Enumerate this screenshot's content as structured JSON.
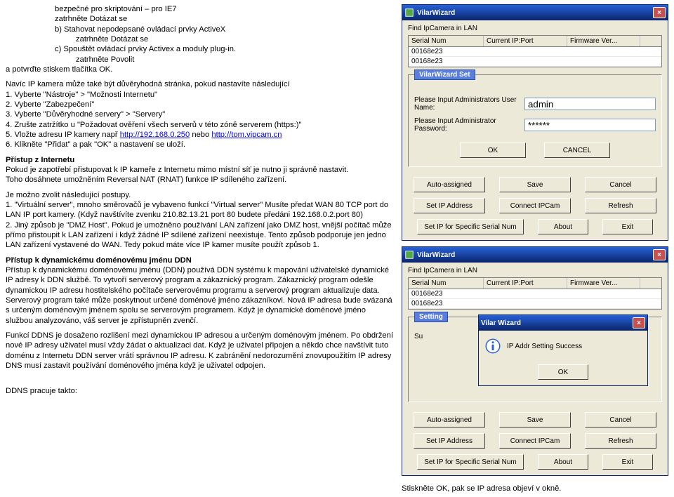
{
  "doc": {
    "l1": "bezpečné pro skriptování – pro IE7",
    "l2": "zatrhněte Dotázat se",
    "l3": "b) Stahovat nepodepsané ovládací prvky ActiveX",
    "l4": "zatrhněte Dotázat se",
    "l5": "c) Spouštět ovládací prvky Activex a moduly plug-in.",
    "l6": "zatrhněte Povolit",
    "l7": "a potvrďte stiskem tlačítka OK.",
    "p1a": "Navíc IP kamera může také být důvěryhodná stránka, pokud nastavíte následující",
    "p1b": "1. Vyberte \"Nástroje\" > \"Možnosti Internetu\"",
    "p1c": "2. Vyberte \"Zabezpečení\"",
    "p1d": "3. Vyberte \"Důvěryhodné servery\" > \"Servery\"",
    "p1e": "4. Zrušte zatržítko u \"Požadovat ověření všech serverů v této zóně serverem (https:)\"",
    "p1f_pre": "5. Vložte adresu IP kamery např ",
    "p1f_link1": "http://192.168.0.250",
    "p1f_mid": " nebo ",
    "p1f_link2": "http://tom.vipcam.cn",
    "p1g": "6. Klikněte \"Přidat\" a pak \"OK\" a nastavení se uloží.",
    "h2": "Přístup z Internetu",
    "p2a": "Pokud je zapotřebí přistupovat k IP kameře z Internetu mimo místní síť je nutno ji správně nastavit.",
    "p2b": "Toho dosáhnete umožněním Reversal NAT (RNAT) funkce IP sdíleného zařízení.",
    "p3a": "Je možno zvolit následující postupy.",
    "p3b": "1. \"Virtuální server\", mnoho směrovačů je vybaveno funkcí \"Virtual server\" Musíte předat WAN 80 TCP port do LAN IP port kamery. (Když navštívíte zvenku 210.82.13.21 port 80 budete předáni 192.168.0.2.port 80)",
    "p3c": "2. Jiný způsob je \"DMZ Host\". Pokud je umožněno používání LAN zařízení jako DMZ host, vnější počítač může přímo přistoupit k LAN zařízení i když žádné IP sdílené zařízení neexistuje. Tento způsob podporuje jen jedno LAN zařízení vystavené do WAN. Tedy pokud máte více IP kamer musíte použít způsob 1.",
    "h3": "Přístup k dynamickému doménovému jménu DDN",
    "p4": "Přístup k dynamickému doménovému jménu (DDN) používá DDN systému k mapování uživatelské dynamické IP adresy k DDN službě. To vytvoří serverový program a zákaznický program. Zákaznický program odešle dynamickou IP adresu hostitelského počítače serverovému programu a serverový program aktualizuje data. Serverový program také může poskytnout určené doménové jméno zákazníkovi. Nová IP adresa bude svázaná s určeným doménovým jménem spolu se serverovým programem. Když je dynamické doménové jméno službou analyzováno, váš server je zpřístupněn zvenčí.",
    "p5": "Funkcí DDNS je dosaženo rozlišení mezi dynamickou IP adresou a určeným doménovým jménem. Po obdržení nové IP adresy uživatel musí vždy žádat o aktualizaci dat. Když je uživatel připojen a někdo chce navštívit tuto doménu z Internetu DDN server vrátí správnou IP adresu. K zabránění nedorozumění znovupoužitím IP adresy DNS musí zastavit používání doménového jména když je uživatel odpojen.",
    "p6": "DDNS pracuje takto:"
  },
  "wiz": {
    "title": "VilarWizard",
    "findLbl": "Find IpCamera in LAN",
    "th": {
      "c1": "Serial Num",
      "c2": "Current IP:Port",
      "c3": "Firmware Ver..."
    },
    "rows": [
      {
        "c1": "00168e23",
        "c2": "",
        "c3": ""
      },
      {
        "c1": "00168e23",
        "c2": "",
        "c3": ""
      }
    ],
    "setTitle": "VilarWizard Set",
    "lblUser": "Please Input Administrators User Name:",
    "valUser": "admin",
    "lblPass": "Please Input Administrator Password:",
    "valPass": "******",
    "okBtn": "OK",
    "cancelBtn": "CANCEL",
    "b_auto": "Auto-assigned",
    "b_save": "Save",
    "b_cancel": "Cancel",
    "b_setip": "Set IP Address",
    "b_connect": "Connect IPCam",
    "b_refresh": "Refresh",
    "b_setserial": "Set IP for Specific Serial Num",
    "b_about": "About",
    "b_exit": "Exit"
  },
  "wiz2": {
    "title": "VilarWizard",
    "findLbl": "Find IpCamera in LAN",
    "th": {
      "c1": "Serial Num",
      "c2": "Current IP:Port",
      "c3": "Firmware Ver..."
    },
    "rows": [
      {
        "c1": "00168e23",
        "c2": "",
        "c3": ""
      },
      {
        "c1": "00168e23",
        "c2": "",
        "c3": ""
      }
    ],
    "settingTitle": "Setting",
    "suLbl": "Su",
    "popup": {
      "title": "Vilar Wizard",
      "msg": "IP Addr Setting Success",
      "ok": "OK"
    },
    "b_auto": "Auto-assigned",
    "b_save": "Save",
    "b_cancel": "Cancel",
    "b_setip": "Set IP Address",
    "b_connect": "Connect IPCam",
    "b_refresh": "Refresh",
    "b_setserial": "Set IP for Specific Serial Num",
    "b_about": "About",
    "b_exit": "Exit"
  },
  "footer": "Stiskněte OK, pak se IP adresa objeví v okně."
}
